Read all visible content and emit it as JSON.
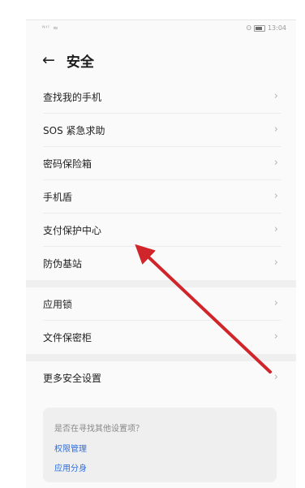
{
  "status_bar": {
    "left": "\"ᴺᴵ⁾ ≈",
    "right_icons": "ʘ",
    "time": "13:04"
  },
  "header": {
    "back_icon": "arrow-left",
    "title": "安全"
  },
  "group1": [
    {
      "label": "查找我的手机"
    },
    {
      "label": "SOS 紧急求助"
    },
    {
      "label": "密码保险箱"
    },
    {
      "label": "手机盾"
    },
    {
      "label": "支付保护中心"
    },
    {
      "label": "防伪基站"
    }
  ],
  "group2": [
    {
      "label": "应用锁"
    },
    {
      "label": "文件保密柜"
    }
  ],
  "group3": [
    {
      "label": "更多安全设置"
    }
  ],
  "suggestion_card": {
    "title": "是否在寻找其他设置项？",
    "links": [
      "权限管理",
      "应用分身"
    ]
  },
  "annotation": {
    "color": "#d0252b",
    "points_to": "支付保护中心"
  }
}
